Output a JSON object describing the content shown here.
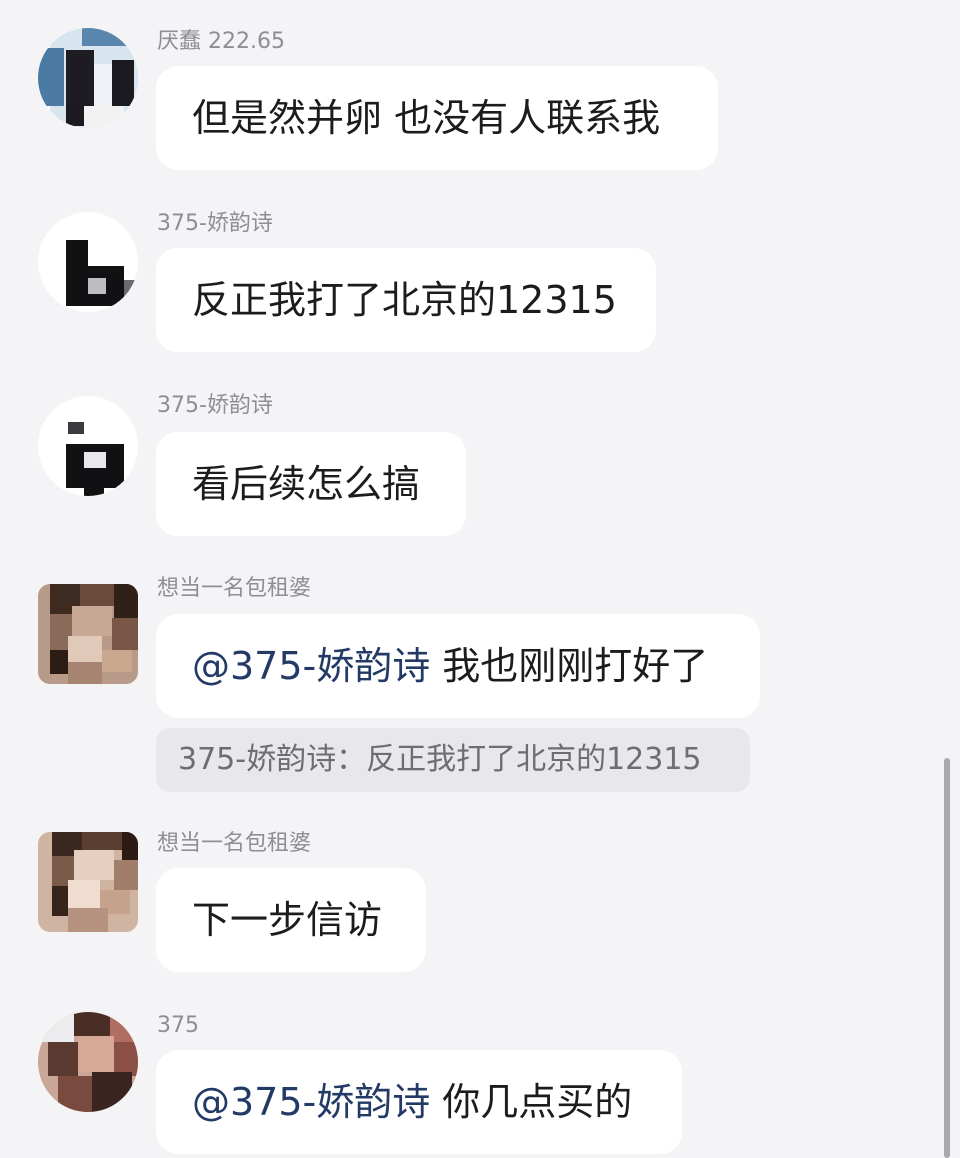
{
  "messages": [
    {
      "sender": "厌蠢 222.65",
      "text": "但是然并卵 也没有人联系我",
      "avatar_icon": "user-avatar-blurred"
    },
    {
      "sender": "375-娇韵诗",
      "text": "反正我打了北京的12315",
      "avatar_icon": "user-avatar-blurred"
    },
    {
      "sender": "375-娇韵诗",
      "text": "看后续怎么搞",
      "avatar_icon": "user-avatar-blurred"
    },
    {
      "sender": "想当一名包租婆",
      "mention": "@375-娇韵诗",
      "text": "我也刚刚打好了",
      "quote": "375-娇韵诗：反正我打了北京的12315",
      "avatar_icon": "user-avatar-blurred"
    },
    {
      "sender": "想当一名包租婆",
      "text": "下一步信访",
      "avatar_icon": "user-avatar-blurred"
    },
    {
      "sender": "375",
      "mention": "@375-娇韵诗",
      "text": "你几点买的",
      "avatar_icon": "user-avatar-blurred"
    }
  ],
  "colors": {
    "background": "#f4f4f6",
    "bubble": "#ffffff",
    "mention": "#233a66",
    "sender": "#8e8e93",
    "quote_bg": "#e8e8ea"
  }
}
